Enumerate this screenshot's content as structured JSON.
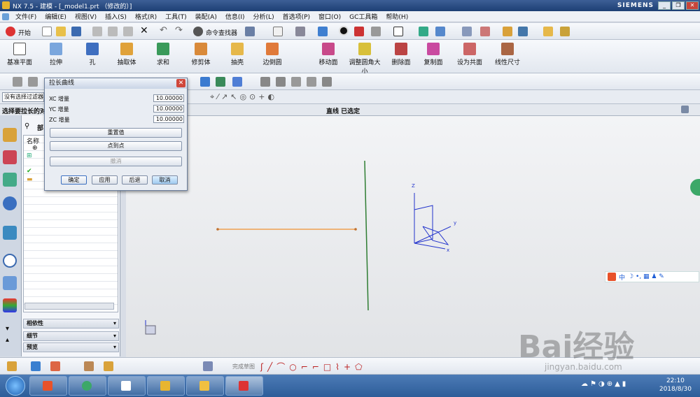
{
  "window": {
    "title": "NX 7.5 - 建模 - [_model1.prt （修改的）]",
    "brand": "SIEMENS"
  },
  "menu": [
    "文件(F)",
    "编辑(E)",
    "视图(V)",
    "插入(S)",
    "格式(R)",
    "工具(T)",
    "装配(A)",
    "信息(I)",
    "分析(L)",
    "首选项(P)",
    "窗口(O)",
    "GC工具箱",
    "帮助(H)"
  ],
  "toolbar1": {
    "start": "开始",
    "command_finder": "命令查找器"
  },
  "toolbar2": [
    "基准平面",
    "拉伸",
    "孔",
    "抽取体",
    "求和",
    "修剪体",
    "抽壳",
    "边倒圆",
    "移动面",
    "调整圆角大小",
    "删除面",
    "复制面",
    "设为共面",
    "线性尺寸"
  ],
  "selection": {
    "filter": "没有选择过滤器",
    "prompt": "选择要拉长的对",
    "status": "直线 已选定"
  },
  "dialog": {
    "title": "拉长曲线",
    "fields": [
      {
        "label": "XC 增量",
        "value": "10.00000"
      },
      {
        "label": "YC 增量",
        "value": "10.00000"
      },
      {
        "label": "ZC 增量",
        "value": "10.00000"
      }
    ],
    "buttons": {
      "reset": "重置值",
      "point": "点到点",
      "undo": "撤消",
      "ok": "确定",
      "apply": "应用",
      "back": "后退",
      "cancel": "取消"
    }
  },
  "navigator": {
    "header": "部",
    "column": "名称",
    "sections": [
      "相依性",
      "细节",
      "预览"
    ]
  },
  "axes": {
    "x": "x",
    "y": "y",
    "z": "Z"
  },
  "sketch_toolbar": {
    "finish": "完成草图"
  },
  "clock": {
    "time": "22:10",
    "date": "2018/8/30"
  },
  "ime": {
    "label": "中"
  },
  "watermark": {
    "main": "Bai经验",
    "url": "jingyan.baidu.com"
  },
  "colors": {
    "line_orange": "#f0a050",
    "line_green": "#2e7d32",
    "axes_blue": "#2233cc"
  }
}
